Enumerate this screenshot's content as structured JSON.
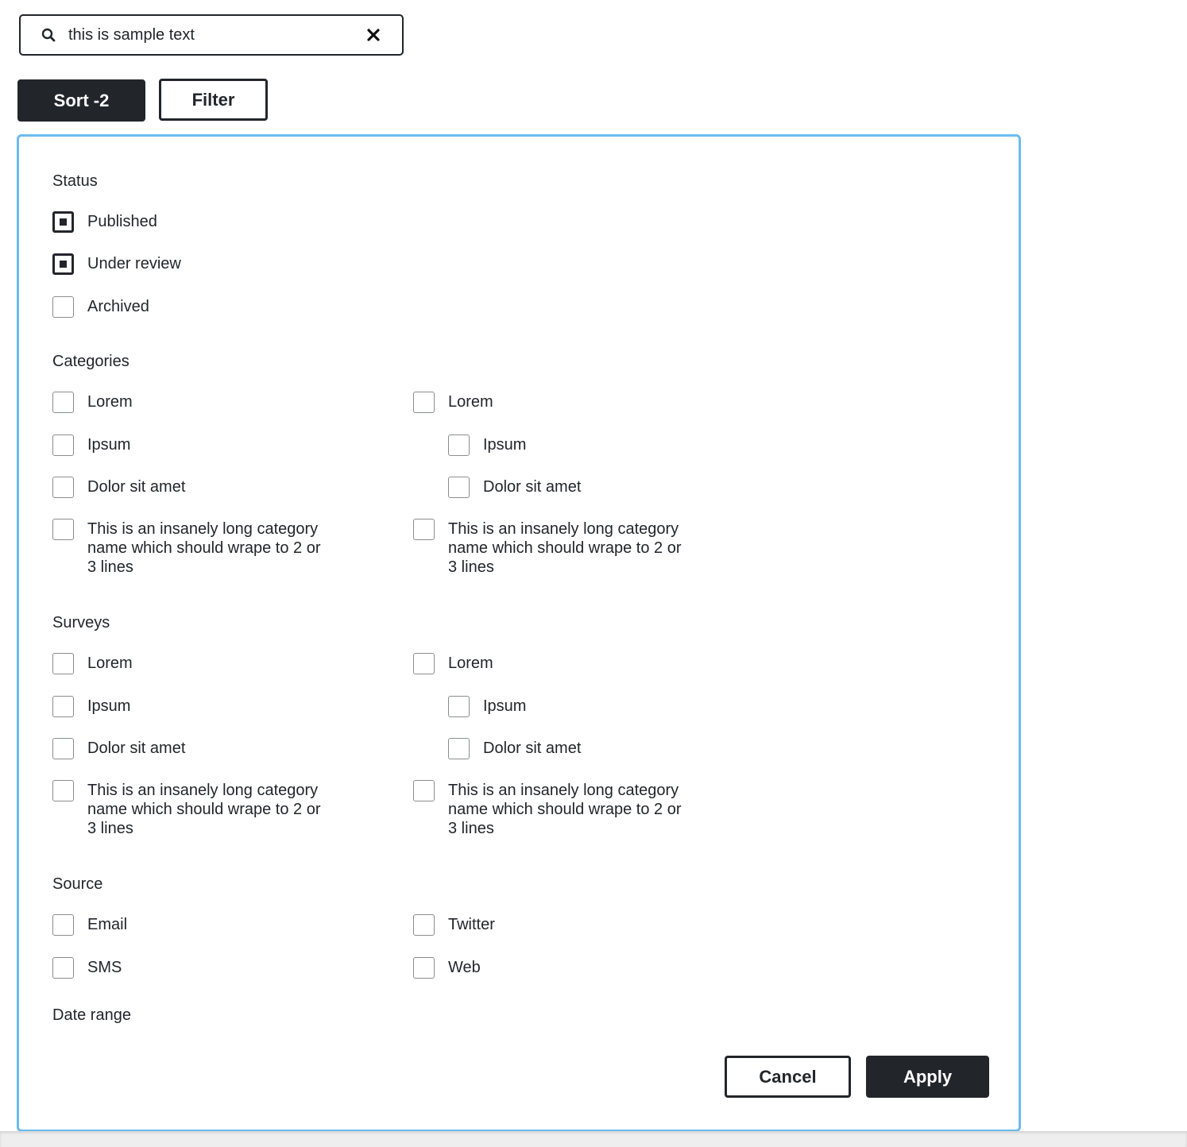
{
  "search": {
    "value": "this is sample text",
    "placeholder": "Search",
    "icon": "search-icon",
    "clear_icon": "close-icon"
  },
  "toolbar": {
    "sort_label": "Sort -2",
    "filter_label": "Filter"
  },
  "filter_panel": {
    "accent_color": "#6bbcf0",
    "status": {
      "title": "Status",
      "items": [
        {
          "label": "Published",
          "checked": true
        },
        {
          "label": "Under review",
          "checked": true
        },
        {
          "label": "Archived",
          "checked": false
        }
      ]
    },
    "categories": {
      "title": "Categories",
      "left": [
        {
          "label": "Lorem",
          "checked": false
        },
        {
          "label": "Ipsum",
          "checked": false
        },
        {
          "label": "Dolor sit amet",
          "checked": false
        },
        {
          "label": "This is an insanely long category name which should wrape to 2 or 3 lines",
          "checked": false
        }
      ],
      "right": [
        {
          "label": "Lorem",
          "checked": false
        },
        {
          "label": "Ipsum",
          "checked": false,
          "indented": true
        },
        {
          "label": "Dolor sit amet",
          "checked": false,
          "indented": true
        },
        {
          "label": "This is an insanely long category name which should wrape to 2 or 3 lines",
          "checked": false
        }
      ]
    },
    "surveys": {
      "title": "Surveys",
      "left": [
        {
          "label": "Lorem",
          "checked": false
        },
        {
          "label": "Ipsum",
          "checked": false
        },
        {
          "label": "Dolor sit amet",
          "checked": false
        },
        {
          "label": "This is an insanely long category name which should wrape to 2 or 3 lines",
          "checked": false
        }
      ],
      "right": [
        {
          "label": "Lorem",
          "checked": false
        },
        {
          "label": "Ipsum",
          "checked": false,
          "indented": true
        },
        {
          "label": "Dolor sit amet",
          "checked": false,
          "indented": true
        },
        {
          "label": "This is an insanely long category name which should wrape to 2 or 3 lines",
          "checked": false
        }
      ]
    },
    "source": {
      "title": "Source",
      "left": [
        {
          "label": "Email",
          "checked": false
        },
        {
          "label": "SMS",
          "checked": false
        }
      ],
      "right": [
        {
          "label": "Twitter",
          "checked": false
        },
        {
          "label": "Web",
          "checked": false
        }
      ]
    },
    "date_range": {
      "title": "Date range"
    },
    "cancel_label": "Cancel",
    "apply_label": "Apply"
  }
}
